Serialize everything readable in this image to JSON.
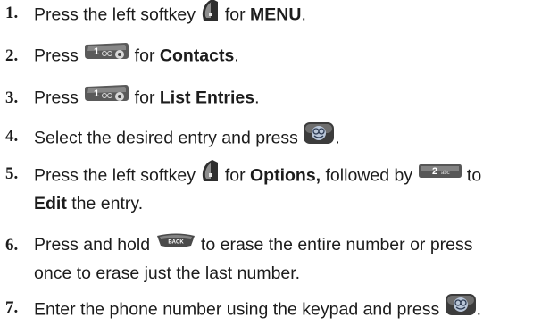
{
  "steps": [
    {
      "number": "1.",
      "segments": [
        {
          "t": "Press the left softkey "
        },
        {
          "icon": "left-softkey"
        },
        {
          "t": " for "
        },
        {
          "t": "MENU",
          "b": true
        },
        {
          "t": "."
        }
      ]
    },
    {
      "number": "2.",
      "segments": [
        {
          "t": "Press "
        },
        {
          "icon": "key-1"
        },
        {
          "t": " for "
        },
        {
          "t": "Contacts",
          "b": true
        },
        {
          "t": "."
        }
      ]
    },
    {
      "number": "3.",
      "segments": [
        {
          "t": "Press "
        },
        {
          "icon": "key-1"
        },
        {
          "t": " for "
        },
        {
          "t": "List Entries",
          "b": true
        },
        {
          "t": "."
        }
      ]
    },
    {
      "number": "4.",
      "segments": [
        {
          "t": "Select the desired entry and press "
        },
        {
          "icon": "ok-key"
        },
        {
          "t": "."
        }
      ]
    },
    {
      "number": "5.",
      "lines": [
        [
          {
            "t": "Press the left softkey "
          },
          {
            "icon": "left-softkey"
          },
          {
            "t": " for "
          },
          {
            "t": "Options,",
            "b": true
          },
          {
            "t": " followed by "
          },
          {
            "icon": "key-2"
          },
          {
            "t": " to"
          }
        ],
        [
          {
            "t": "Edit",
            "b": true
          },
          {
            "t": " the entry."
          }
        ]
      ]
    },
    {
      "number": "6.",
      "lines": [
        [
          {
            "t": "Press and hold "
          },
          {
            "icon": "back-key"
          },
          {
            "t": " to erase the entire number or press"
          }
        ],
        [
          {
            "t": "once to erase just the last number."
          }
        ]
      ]
    },
    {
      "number": "7.",
      "segments": [
        {
          "t": "Enter the phone number using the keypad and press "
        },
        {
          "icon": "ok-key"
        },
        {
          "t": "."
        }
      ]
    }
  ],
  "icon_labels": {
    "key-1": "1",
    "key-2": "2",
    "key-2-sub": "abc",
    "back-key": "BACK"
  },
  "colors": {
    "text": "#1c1c1c",
    "key_dark": "#3a3a3a",
    "key_light": "#c8c8c8",
    "ok_blue": "#b9c6d8"
  }
}
